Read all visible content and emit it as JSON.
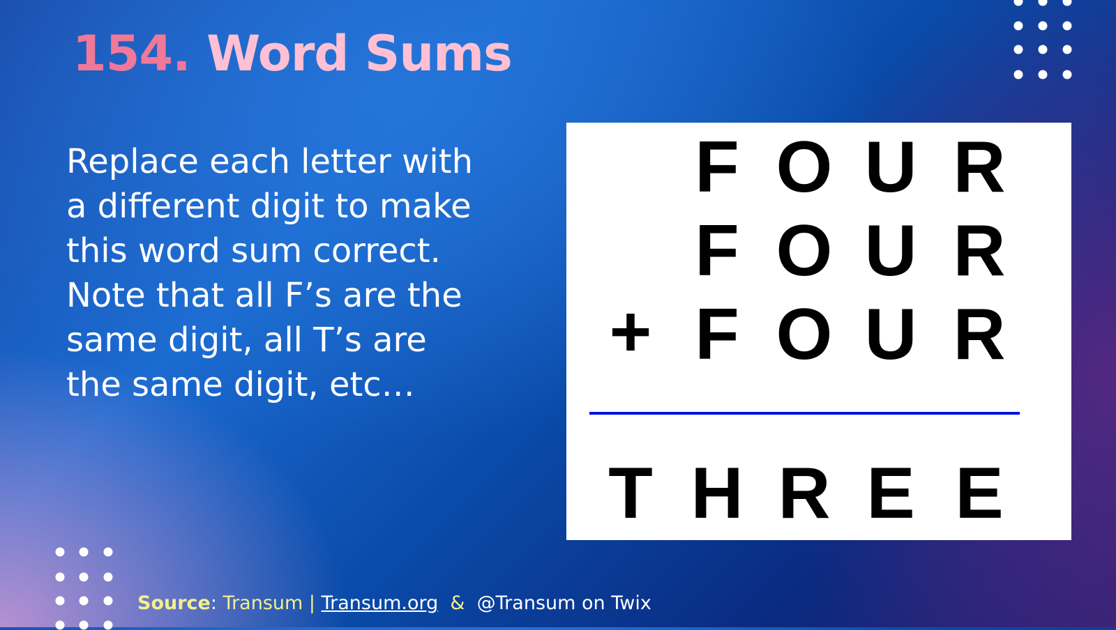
{
  "title": {
    "number": "154.",
    "name": "Word Sums"
  },
  "description": "Replace each letter with a different digit to make this word sum correct. Note that all F’s are the same digit, all T’s are the same digit, etc…",
  "puzzle": {
    "rows": [
      [
        "F",
        "O",
        "U",
        "R"
      ],
      [
        "F",
        "O",
        "U",
        "R"
      ],
      [
        "F",
        "O",
        "U",
        "R"
      ]
    ],
    "operator": "+",
    "result": [
      "T",
      "H",
      "R",
      "E",
      "E"
    ],
    "rule_color": "#0010e0"
  },
  "source": {
    "label": "Source",
    "colon": ":",
    "text": " Transum ",
    "sep": "|",
    "link": "Transum.org",
    "amp": "&",
    "twitter": "@Transum on Twix"
  }
}
